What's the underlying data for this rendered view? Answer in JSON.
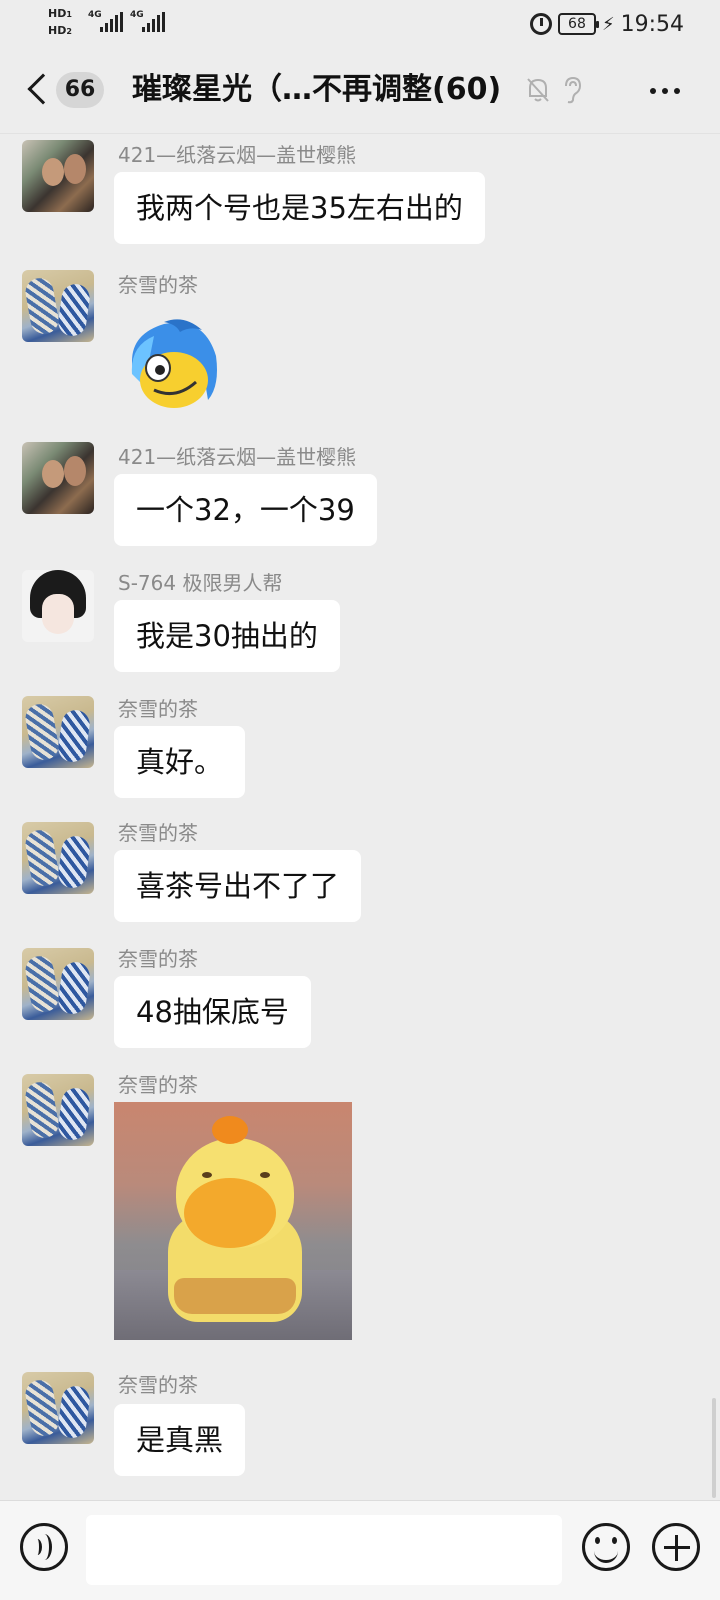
{
  "status_bar": {
    "hd1": "HD",
    "hd1_sub": "1",
    "hd2": "HD",
    "hd2_sub": "2",
    "net1": "4G",
    "net2": "4G",
    "battery": "68",
    "time": "19:54",
    "icons": [
      "alarm-icon",
      "battery-icon",
      "charging-bolt-icon"
    ]
  },
  "header": {
    "unread_count": "66",
    "title": "璀璨星光（…不再调整(60)",
    "icons": [
      "back-icon",
      "mute-bell-icon",
      "ear-icon",
      "more-icon"
    ]
  },
  "messages": [
    {
      "sender": "421—纸落云烟—盖世樱熊",
      "avatar": "couple-photo",
      "type": "text",
      "text": "我两个号也是35左右出的"
    },
    {
      "sender": "奈雪的茶",
      "avatar": "shoes-photo",
      "type": "sticker",
      "sticker": "blue-hair-face-sticker"
    },
    {
      "sender": "421—纸落云烟—盖世樱熊",
      "avatar": "couple-photo",
      "type": "text",
      "text": "一个32，一个39"
    },
    {
      "sender": "S-764  极限男人帮",
      "avatar": "anime-portrait",
      "type": "text",
      "text": "我是30抽出的"
    },
    {
      "sender": "奈雪的茶",
      "avatar": "shoes-photo",
      "type": "text",
      "text": "真好。"
    },
    {
      "sender": "奈雪的茶",
      "avatar": "shoes-photo",
      "type": "text",
      "text": "喜茶号出不了了"
    },
    {
      "sender": "奈雪的茶",
      "avatar": "shoes-photo",
      "type": "text",
      "text": "48抽保底号"
    },
    {
      "sender": "奈雪的茶",
      "avatar": "shoes-photo",
      "type": "image",
      "sticker": "capybara-sticker"
    },
    {
      "sender": "奈雪的茶",
      "avatar": "shoes-photo",
      "type": "text",
      "text": "是真黑"
    }
  ],
  "input_bar": {
    "icons": [
      "voice-icon",
      "emoji-icon",
      "add-icon"
    ],
    "message_value": ""
  }
}
